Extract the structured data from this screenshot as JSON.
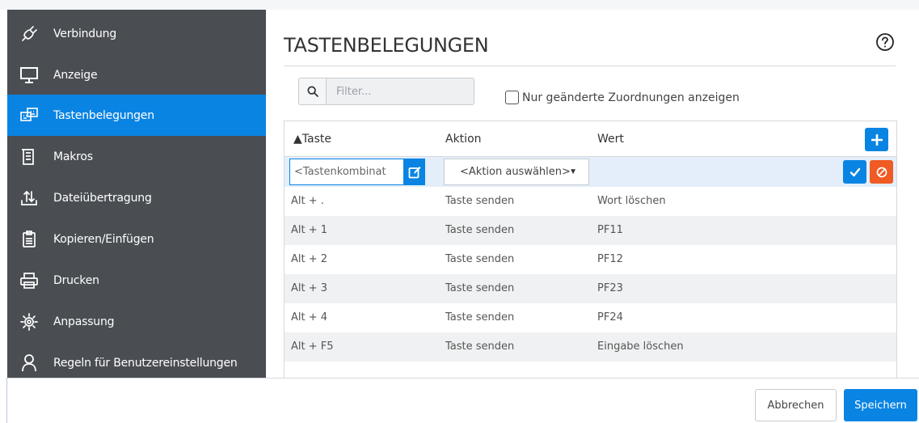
{
  "sidebar": {
    "items": [
      {
        "label": "Verbindung",
        "icon": "plug-icon",
        "active": false
      },
      {
        "label": "Anzeige",
        "icon": "monitor-icon",
        "active": false
      },
      {
        "label": "Tastenbelegungen",
        "icon": "keyboard-mapping-icon",
        "active": true
      },
      {
        "label": "Makros",
        "icon": "document-list-icon",
        "active": false
      },
      {
        "label": "Dateiübertragung",
        "icon": "file-transfer-icon",
        "active": false
      },
      {
        "label": "Kopieren/Einfügen",
        "icon": "clipboard-icon",
        "active": false
      },
      {
        "label": "Drucken",
        "icon": "printer-icon",
        "active": false
      },
      {
        "label": "Anpassung",
        "icon": "gear-icon",
        "active": false
      },
      {
        "label": "Regeln für Benutzereinstellungen",
        "icon": "user-icon",
        "active": false
      }
    ]
  },
  "main": {
    "title": "TASTENBELEGUNGEN",
    "filter": {
      "placeholder": "Filter...",
      "value": ""
    },
    "only_changed_label": "Nur geänderte Zuordnungen anzeigen",
    "only_changed_checked": false
  },
  "table": {
    "headers": {
      "key": "▲Taste",
      "action": "Aktion",
      "value": "Wert"
    },
    "sort": {
      "column": "key",
      "direction": "ascending"
    },
    "edit_row": {
      "key_placeholder": "<Tastenkombinat",
      "action_select": "<Aktion auswählen>"
    },
    "rows": [
      {
        "key": "Alt + .",
        "action": "Taste senden",
        "value": "Wort löschen"
      },
      {
        "key": "Alt + 1",
        "action": "Taste senden",
        "value": "PF11"
      },
      {
        "key": "Alt + 2",
        "action": "Taste senden",
        "value": "PF12"
      },
      {
        "key": "Alt + 3",
        "action": "Taste senden",
        "value": "PF23"
      },
      {
        "key": "Alt + 4",
        "action": "Taste senden",
        "value": "PF24"
      },
      {
        "key": "Alt + F5",
        "action": "Taste senden",
        "value": "Eingabe löschen"
      }
    ]
  },
  "footer": {
    "cancel_label": "Abbrechen",
    "save_label": "Speichern"
  },
  "colors": {
    "sidebar_bg": "#4a4e53",
    "accent": "#0a84e3",
    "danger": "#f05a23",
    "row_alt": "#f0f1f2",
    "edit_row_bg": "#e3eefa"
  }
}
